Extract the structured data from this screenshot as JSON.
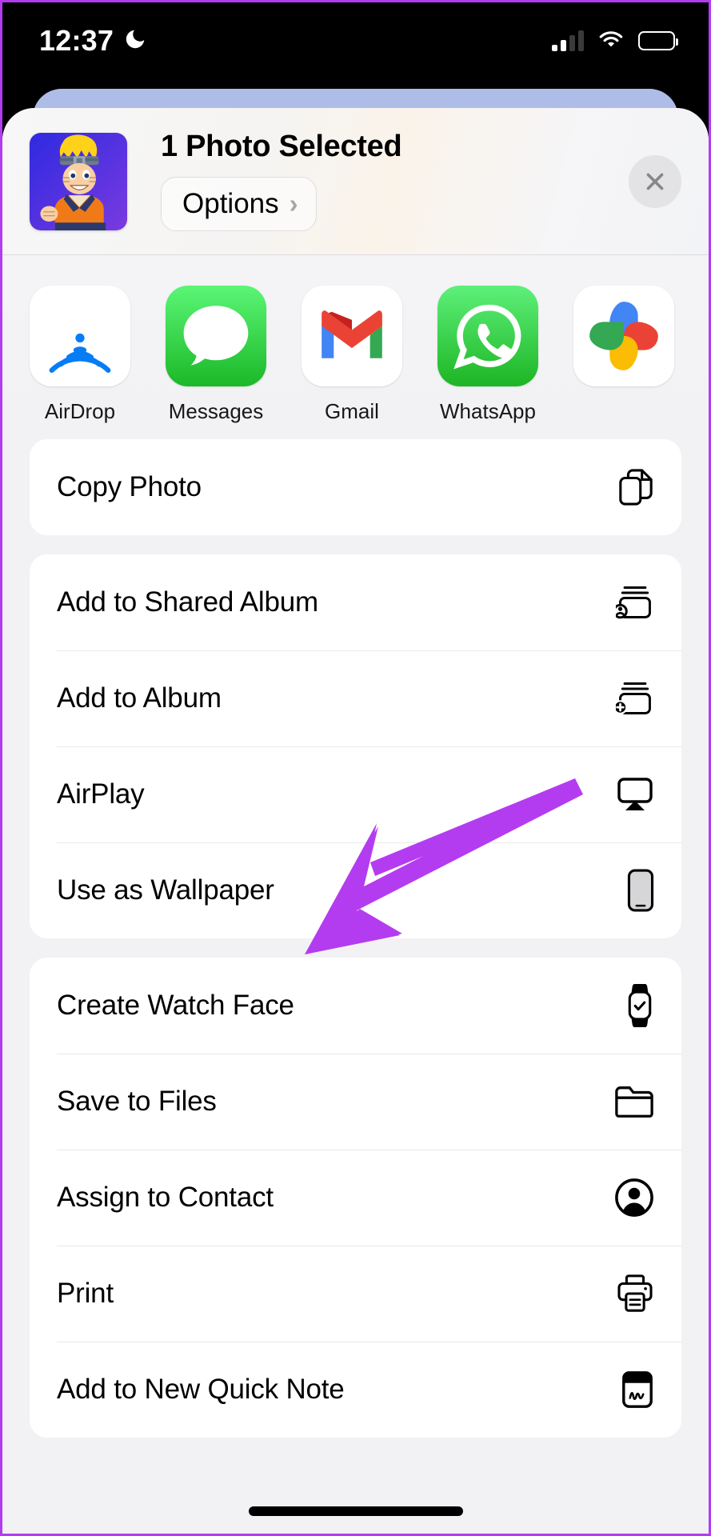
{
  "status_bar": {
    "time": "12:37",
    "moon_icon": "crescent-moon-icon",
    "signal_icon": "cellular-signal-icon",
    "signal_bars_filled": 2,
    "signal_bars_total": 4,
    "wifi_icon": "wifi-icon",
    "battery_icon": "battery-full-icon"
  },
  "share_sheet": {
    "title": "1 Photo Selected",
    "options_label": "Options",
    "options_chevron": "chevron-right-icon",
    "close_icon": "close-icon",
    "thumbnail_name": "selected-photo-thumbnail",
    "apps": [
      {
        "label": "AirDrop",
        "icon": "airdrop-icon"
      },
      {
        "label": "Messages",
        "icon": "messages-icon"
      },
      {
        "label": "Gmail",
        "icon": "gmail-icon"
      },
      {
        "label": "WhatsApp",
        "icon": "whatsapp-icon"
      },
      {
        "label": "",
        "icon": "google-photos-icon"
      }
    ],
    "groups": [
      {
        "rows": [
          {
            "label": "Copy Photo",
            "icon": "copy-icon"
          }
        ]
      },
      {
        "rows": [
          {
            "label": "Add to Shared Album",
            "icon": "shared-album-icon"
          },
          {
            "label": "Add to Album",
            "icon": "add-album-icon"
          },
          {
            "label": "AirPlay",
            "icon": "airplay-icon"
          },
          {
            "label": "Use as Wallpaper",
            "icon": "wallpaper-iphone-icon"
          }
        ]
      },
      {
        "rows": [
          {
            "label": "Create Watch Face",
            "icon": "watch-icon"
          },
          {
            "label": "Save to Files",
            "icon": "folder-icon"
          },
          {
            "label": "Assign to Contact",
            "icon": "contact-person-icon"
          },
          {
            "label": "Print",
            "icon": "printer-icon"
          },
          {
            "label": "Add to New Quick Note",
            "icon": "quick-note-icon"
          }
        ]
      }
    ]
  },
  "annotation": {
    "arrow_icon": "purple-pointer-arrow",
    "arrow_color": "#b43cf0",
    "points_at": "Use as Wallpaper"
  },
  "colors": {
    "sheet_background": "#f2f2f4",
    "row_background": "#ffffff",
    "accent_purple": "#b43cf0",
    "separator": "#e9e9eb"
  }
}
